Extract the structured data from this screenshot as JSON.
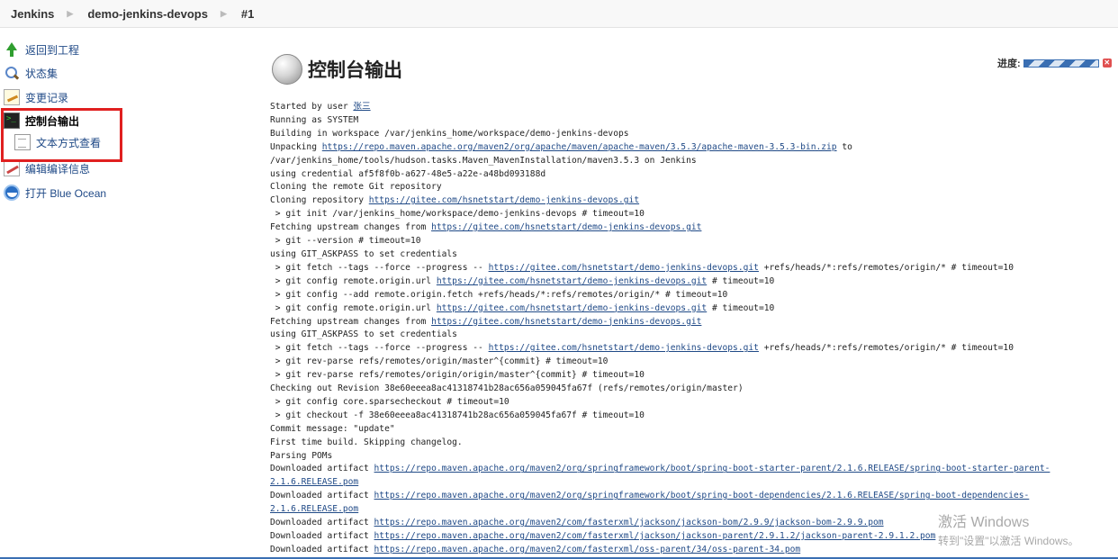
{
  "breadcrumb": [
    "Jenkins",
    "demo-jenkins-devops",
    "#1"
  ],
  "sidebar": {
    "items": [
      {
        "label": "返回到工程",
        "icon": "up-arrow-icon"
      },
      {
        "label": "状态集",
        "icon": "search-icon"
      },
      {
        "label": "变更记录",
        "icon": "notepad-icon"
      },
      {
        "label": "控制台输出",
        "icon": "terminal-icon"
      },
      {
        "label": "文本方式查看",
        "icon": "document-icon"
      },
      {
        "label": "编辑编译信息",
        "icon": "edit-icon"
      },
      {
        "label": "打开 Blue Ocean",
        "icon": "blue-ocean-icon"
      }
    ]
  },
  "main": {
    "title": "控制台输出",
    "progress_label": "进度:"
  },
  "console": {
    "line_1_prefix": "Started by user ",
    "line_1_user": "张三",
    "running_as": "Running as SYSTEM",
    "building_in": "Building in workspace /var/jenkins_home/workspace/demo-jenkins-devops",
    "unpacking_prefix": "Unpacking ",
    "unpacking_url": "https://repo.maven.apache.org/maven2/org/apache/maven/apache-maven/3.5.3/apache-maven-3.5.3-bin.zip",
    "unpacking_suffix": " to",
    "install_path": "/var/jenkins_home/tools/hudson.tasks.Maven_MavenInstallation/maven3.5.3 on Jenkins",
    "using_credential": "using credential af5f8f0b-a627-48e5-a22e-a48bd093188d",
    "cloning_remote": "Cloning the remote Git repository",
    "cloning_repo_prefix": "Cloning repository ",
    "repo_url": "https://gitee.com/hsnetstart/demo-jenkins-devops.git",
    "git_init": " > git init /var/jenkins_home/workspace/demo-jenkins-devops # timeout=10",
    "fetching_upstream_prefix": "Fetching upstream changes from ",
    "git_version": " > git --version # timeout=10",
    "using_askpass": "using GIT_ASKPASS to set credentials",
    "git_fetch_prefix": " > git fetch --tags --force --progress -- ",
    "git_fetch_suffix": " +refs/heads/*:refs/remotes/origin/* # timeout=10",
    "git_config_url_prefix": " > git config remote.origin.url ",
    "git_config_url_suffix": " # timeout=10",
    "git_config_add": " > git config --add remote.origin.fetch +refs/heads/*:refs/remotes/origin/* # timeout=10",
    "rev_parse_1": " > git rev-parse refs/remotes/origin/master^{commit} # timeout=10",
    "rev_parse_2": " > git rev-parse refs/remotes/origin/origin/master^{commit} # timeout=10",
    "checking_out": "Checking out Revision 38e60eeea8ac41318741b28ac656a059045fa67f (refs/remotes/origin/master)",
    "sparse": " > git config core.sparsecheckout # timeout=10",
    "checkout": " > git checkout -f 38e60eeea8ac41318741b28ac656a059045fa67f # timeout=10",
    "commit_message": "Commit message: \"update\"",
    "first_build": "First time build. Skipping changelog.",
    "parsing_poms": "Parsing POMs",
    "downloaded_prefix": "Downloaded artifact ",
    "artifact_1_a": "https://repo.maven.apache.org/maven2/org/springframework/boot/spring-boot-starter-parent/2.1.6.RELEASE/spring-boot-starter-parent-",
    "artifact_1_b": "2.1.6.RELEASE.pom",
    "artifact_2_a": "https://repo.maven.apache.org/maven2/org/springframework/boot/spring-boot-dependencies/2.1.6.RELEASE/spring-boot-dependencies-",
    "artifact_2_b": "2.1.6.RELEASE.pom",
    "artifact_3": "https://repo.maven.apache.org/maven2/com/fasterxml/jackson/jackson-bom/2.9.9/jackson-bom-2.9.9.pom",
    "artifact_4": "https://repo.maven.apache.org/maven2/com/fasterxml/jackson/jackson-parent/2.9.1.2/jackson-parent-2.9.1.2.pom",
    "artifact_5": "https://repo.maven.apache.org/maven2/com/fasterxml/oss-parent/34/oss-parent-34.pom"
  },
  "watermark": {
    "line1": "激活 Windows",
    "line2": "转到\"设置\"以激活 Windows。"
  }
}
